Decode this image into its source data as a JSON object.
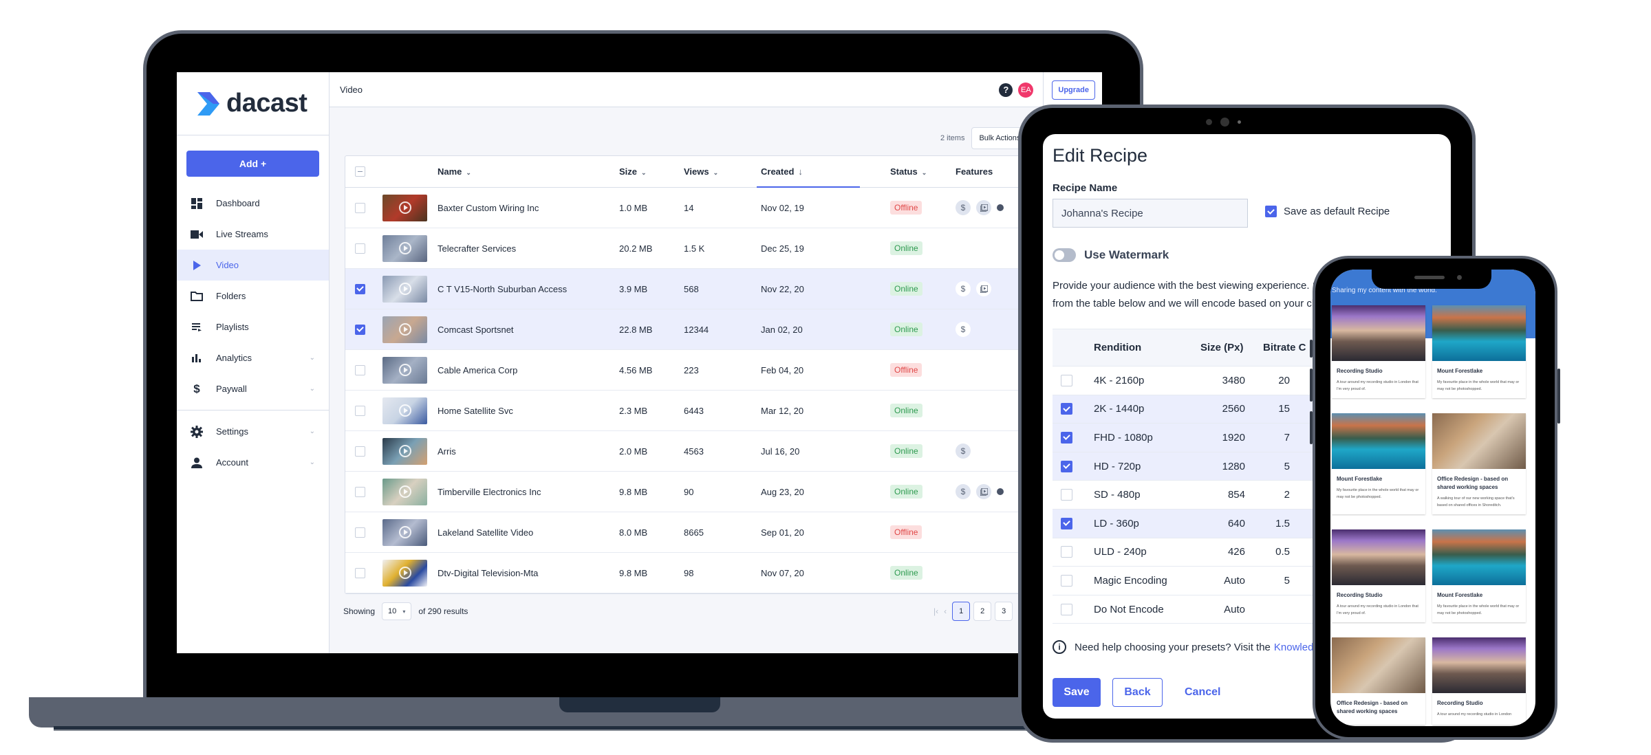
{
  "app": {
    "brand": "dacast",
    "add_button": "Add +",
    "page_title": "Video",
    "avatar_initials": "EA",
    "help_icon": "?",
    "upgrade_button": "Upgrade",
    "accent_color": "#4b65ea"
  },
  "sidebar": {
    "items": [
      {
        "label": "Dashboard",
        "icon": "dashboard-icon"
      },
      {
        "label": "Live Streams",
        "icon": "video-camera-icon"
      },
      {
        "label": "Video",
        "icon": "play-icon",
        "active": true
      },
      {
        "label": "Folders",
        "icon": "folder-icon"
      },
      {
        "label": "Playlists",
        "icon": "playlist-icon"
      },
      {
        "label": "Analytics",
        "icon": "bar-chart-icon",
        "expandable": true
      },
      {
        "label": "Paywall",
        "icon": "dollar-icon",
        "expandable": true
      },
      {
        "label": "Settings",
        "icon": "gear-icon",
        "expandable": true
      },
      {
        "label": "Account",
        "icon": "user-icon",
        "expandable": true
      }
    ]
  },
  "toolbar": {
    "items_count": "2 items",
    "bulk_actions": "Bulk Actions"
  },
  "table": {
    "columns": [
      "Name",
      "Size",
      "Views",
      "Created",
      "Status",
      "Features"
    ],
    "rows": [
      {
        "name": "Baxter Custom Wiring Inc",
        "size": "1.0 MB",
        "views": "14",
        "created": "Nov 02, 19",
        "status": "Offline",
        "selected": false,
        "features": [
          "paywall",
          "playlist",
          "more"
        ]
      },
      {
        "name": "Telecrafter Services",
        "size": "20.2 MB",
        "views": "1.5 K",
        "created": "Dec 25, 19",
        "status": "Online",
        "selected": false,
        "features": []
      },
      {
        "name": "C T V15-North Suburban Access",
        "size": "3.9 MB",
        "views": "568",
        "created": "Nov 22, 20",
        "status": "Online",
        "selected": true,
        "features": [
          "paywall",
          "playlist"
        ]
      },
      {
        "name": "Comcast Sportsnet",
        "size": "22.8 MB",
        "views": "12344",
        "created": "Jan 02, 20",
        "status": "Online",
        "selected": true,
        "features": [
          "paywall"
        ]
      },
      {
        "name": "Cable America Corp",
        "size": "4.56 MB",
        "views": "223",
        "created": "Feb 04, 20",
        "status": "Offline",
        "selected": false,
        "features": []
      },
      {
        "name": "Home Satellite Svc",
        "size": "2.3 MB",
        "views": "6443",
        "created": "Mar 12, 20",
        "status": "Online",
        "selected": false,
        "features": []
      },
      {
        "name": "Arris",
        "size": "2.0 MB",
        "views": "4563",
        "created": "Jul 16, 20",
        "status": "Online",
        "selected": false,
        "features": [
          "paywall"
        ]
      },
      {
        "name": "Timberville Electronics Inc",
        "size": "9.8 MB",
        "views": "90",
        "created": "Aug 23, 20",
        "status": "Online",
        "selected": false,
        "features": [
          "paywall",
          "playlist",
          "more"
        ]
      },
      {
        "name": "Lakeland Satellite Video",
        "size": "8.0 MB",
        "views": "8665",
        "created": "Sep 01, 20",
        "status": "Offline",
        "selected": false,
        "features": []
      },
      {
        "name": "Dtv-Digital Television-Mta",
        "size": "9.8 MB",
        "views": "98",
        "created": "Nov 07, 20",
        "status": "Online",
        "selected": false,
        "features": []
      }
    ]
  },
  "pagination": {
    "showing_label": "Showing",
    "per_page": "10",
    "results_label": "of 290 results",
    "pages": [
      "1",
      "2",
      "3"
    ],
    "current_page": "1"
  },
  "edit_recipe": {
    "title": "Edit Recipe",
    "name_label": "Recipe Name",
    "name_value": "Johanna's Recipe",
    "default_label": "Save as default Recipe",
    "default_checked": true,
    "watermark_label": "Use Watermark",
    "watermark_on": false,
    "description_line1": "Provide your audience with the best viewing experience. Se",
    "description_line2": "from the table below and we will encode based on your cho",
    "columns": [
      "Rendition",
      "Size (Px)",
      "Bitrate C"
    ],
    "renditions": [
      {
        "name": "4K - 2160p",
        "size": "3480",
        "bitrate": "20",
        "checked": false
      },
      {
        "name": "2K - 1440p",
        "size": "2560",
        "bitrate": "15",
        "checked": true
      },
      {
        "name": "FHD - 1080p",
        "size": "1920",
        "bitrate": "7",
        "checked": true
      },
      {
        "name": "HD - 720p",
        "size": "1280",
        "bitrate": "5",
        "checked": true
      },
      {
        "name": "SD - 480p",
        "size": "854",
        "bitrate": "2",
        "checked": false
      },
      {
        "name": "LD - 360p",
        "size": "640",
        "bitrate": "1.5",
        "checked": true
      },
      {
        "name": "ULD - 240p",
        "size": "426",
        "bitrate": "0.5",
        "checked": false
      },
      {
        "name": "Magic Encoding",
        "size": "Auto",
        "bitrate": "5",
        "checked": false
      },
      {
        "name": "Do Not Encode",
        "size": "Auto",
        "bitrate": "",
        "checked": false
      }
    ],
    "help_text": "Need help choosing your presets? Visit the",
    "help_link": "Knowledge",
    "save_button": "Save",
    "back_button": "Back",
    "cancel_button": "Cancel"
  },
  "phone": {
    "tagline": "Sharing my content with the world.",
    "cards": [
      {
        "title": "Recording Studio",
        "desc": "A tour around my recording studio in London that I'm very proud of.",
        "image": "studio"
      },
      {
        "title": "Mount Forestlake",
        "desc": "My favourite place in the whole world that may or may not be photoshopped.",
        "image": "lake"
      },
      {
        "title": "Mount Forestlake",
        "desc": "My favourite place in the whole world that may or may not be photoshopped.",
        "image": "lake"
      },
      {
        "title": "Office Redesign - based on shared working spaces",
        "desc": "A walking tour of our new working space that's based on shared offices in Shoreditch.",
        "image": "office"
      },
      {
        "title": "Recording Studio",
        "desc": "A tour around my recording studio in London that I'm very proud of.",
        "image": "studio"
      },
      {
        "title": "Mount Forestlake",
        "desc": "My favourite place in the whole world that may or may not be photoshopped.",
        "image": "lake"
      },
      {
        "title": "Office Redesign - based on shared working spaces",
        "desc": "",
        "image": "office"
      },
      {
        "title": "Recording Studio",
        "desc": "A tour around my recording studio in London",
        "image": "studio"
      }
    ]
  }
}
